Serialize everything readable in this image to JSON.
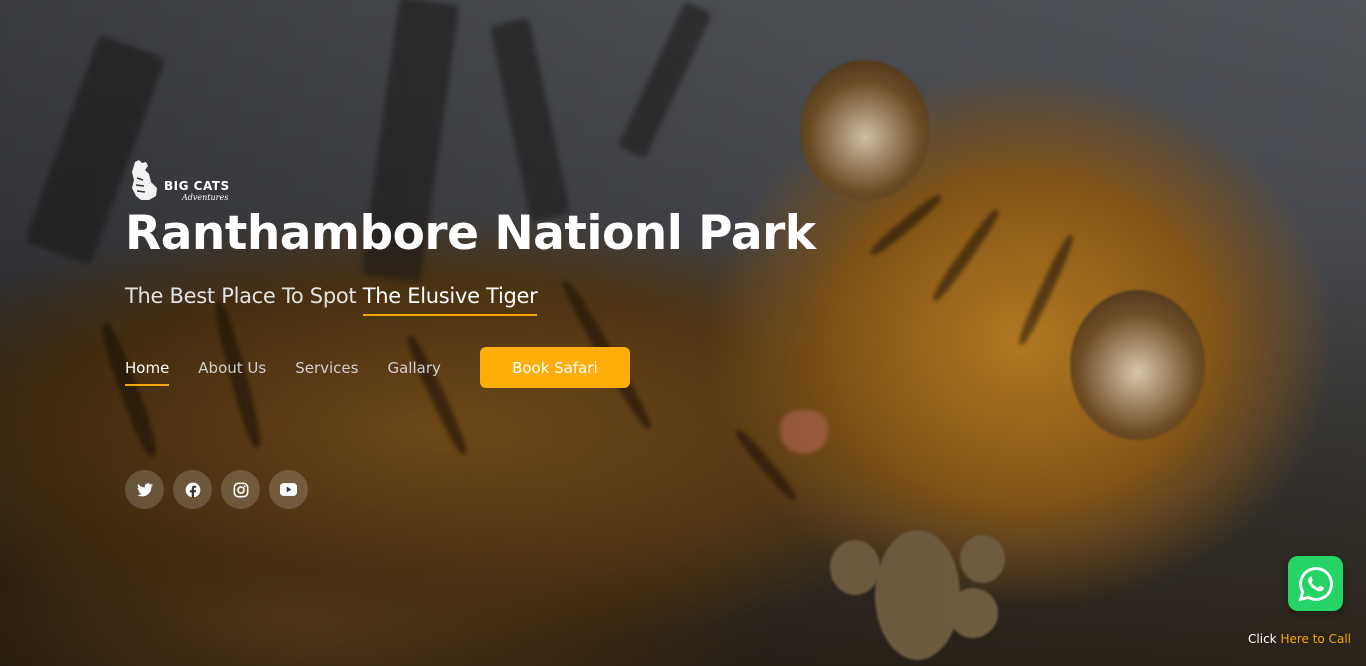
{
  "brand": {
    "logo_main": "BIG CATS",
    "logo_sub": "Adventures",
    "accent": "#fdae0a"
  },
  "hero": {
    "title": "Ranthambore Nationl Park",
    "subtitle_prefix": "The Best Place To Spot ",
    "subtitle_highlight": "The Elusive Tiger"
  },
  "nav": {
    "items": [
      {
        "label": "Home",
        "active": true
      },
      {
        "label": "About Us"
      },
      {
        "label": "Services"
      },
      {
        "label": "Gallary"
      }
    ],
    "cta_label": "Book Safari"
  },
  "social": [
    "twitter-icon",
    "facebook-icon",
    "instagram-icon",
    "youtube-icon"
  ],
  "whatsapp": {
    "icon": "whatsapp-icon",
    "color": "#25d366",
    "call_prefix": "Click ",
    "call_link": "Here to Call"
  }
}
